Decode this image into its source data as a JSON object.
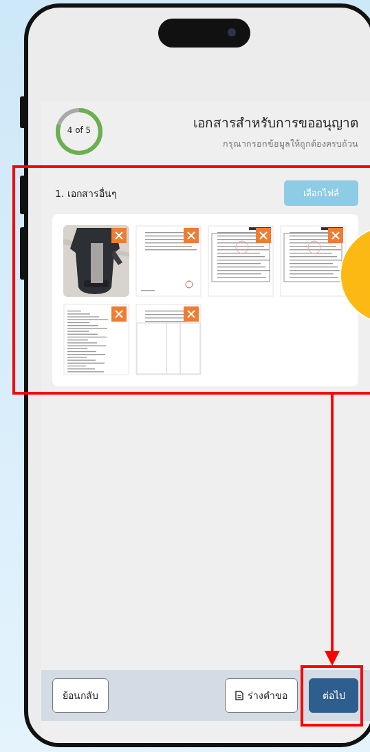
{
  "progress": {
    "label": "4 of 5",
    "level": 0.8
  },
  "header": {
    "title": "เอกสารสำหรับการขออนุญาต",
    "subtitle": "กรุณากรอกข้อมูลให้ถูกต้องครบถ้วน"
  },
  "section": {
    "title": "1. เอกสารอื่นๆ",
    "choose_button": "เลือกไฟล์"
  },
  "files": [
    {
      "kind": "picture"
    },
    {
      "kind": "document"
    },
    {
      "kind": "form"
    },
    {
      "kind": "form"
    },
    {
      "kind": "list"
    },
    {
      "kind": "table"
    }
  ],
  "footer": {
    "back": "ย้อนกลับ",
    "draft": "ร่างคำขอ",
    "next": "ต่อไป"
  }
}
